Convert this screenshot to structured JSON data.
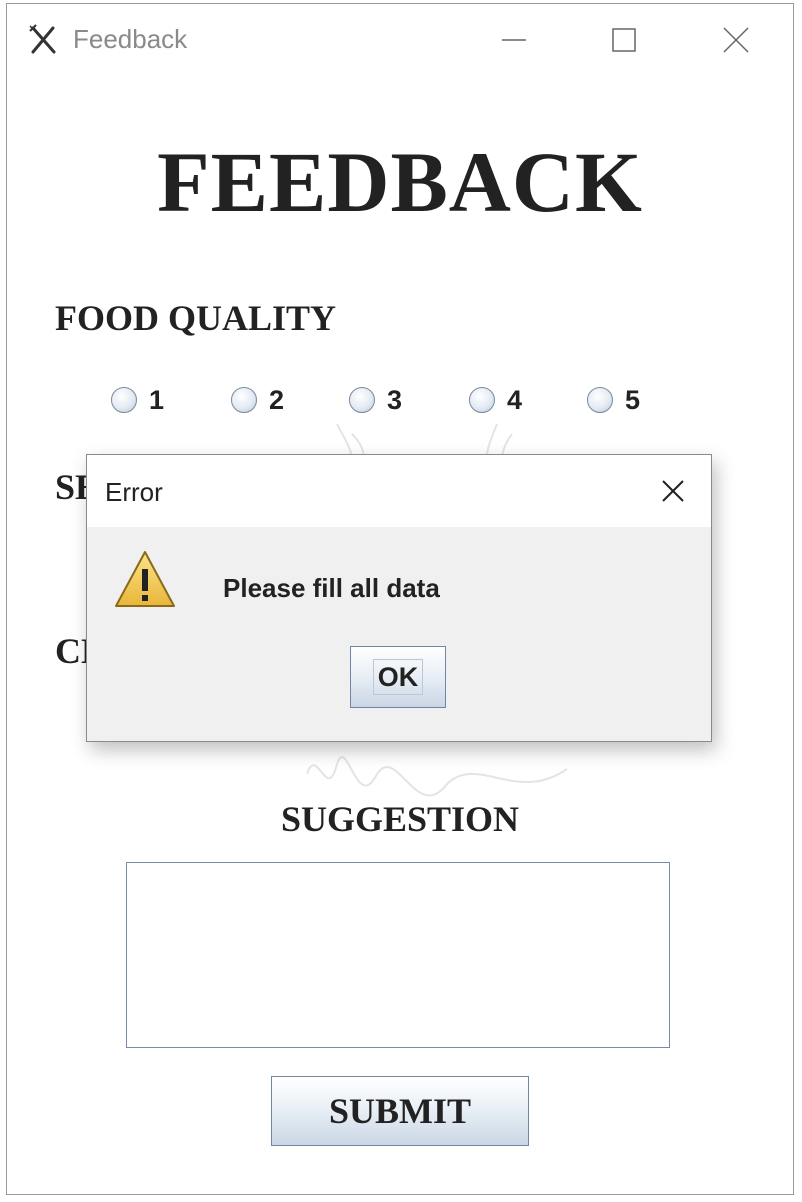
{
  "window": {
    "title": "Feedback",
    "icon": "fork-knife-icon",
    "controls": [
      "minimize-icon",
      "maximize-icon",
      "close-icon"
    ]
  },
  "form": {
    "heading": "FEEDBACK",
    "food_quality": {
      "label": "FOOD QUALITY",
      "options": [
        "1",
        "2",
        "3",
        "4",
        "5"
      ],
      "selected": null
    },
    "service_label_visible": "SE",
    "cleanliness_label_visible": "CL",
    "suggestion": {
      "label": "SUGGESTION",
      "value": ""
    },
    "submit_label": "SUBMIT"
  },
  "dialog": {
    "title": "Error",
    "icon": "warning-icon",
    "message": "Please fill all data",
    "ok_label": "OK"
  },
  "colors": {
    "text": "#222222",
    "button_gradient_bottom": "#cad7e5",
    "button_border": "#6f87a4",
    "warning_yellow": "#f2c94c"
  }
}
